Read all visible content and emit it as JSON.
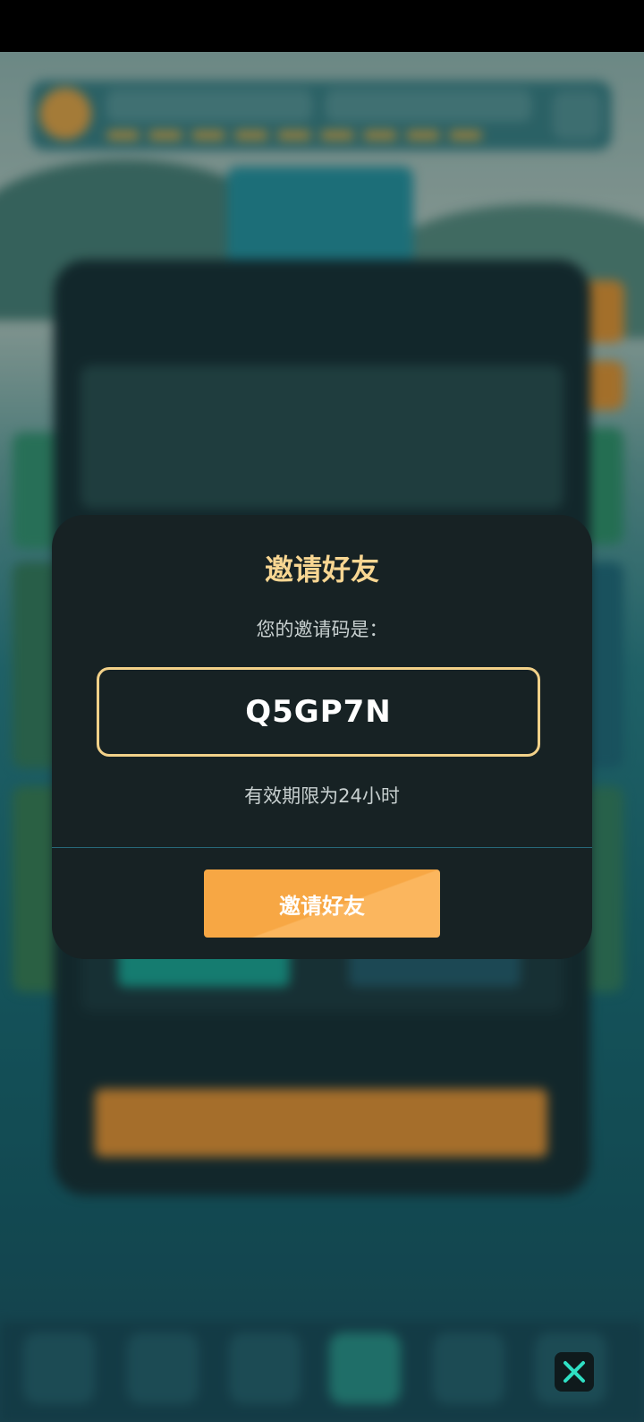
{
  "invite_modal": {
    "title": "邀请好友",
    "code_label": "您的邀请码是：",
    "invite_code": "Q5GP7N",
    "validity_text": "有效期限为24小时",
    "invite_button_label": "邀请好友"
  },
  "close_button": {
    "icon": "close-icon"
  },
  "colors": {
    "modal_bg": "#172224",
    "title": "#f8d692",
    "code_border": "#f2d189",
    "button": "#f7a744",
    "close_icon": "#2fe0c4"
  }
}
